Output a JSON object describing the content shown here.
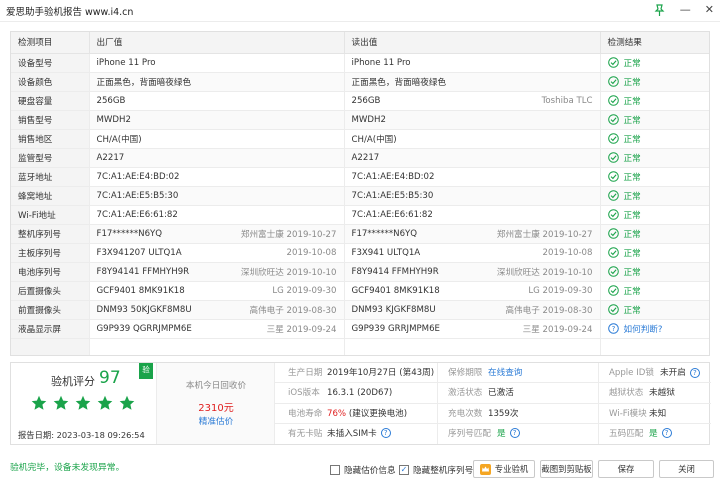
{
  "window": {
    "title": "爱思助手验机报告 www.i4.cn",
    "min": "—",
    "close": "✕"
  },
  "table": {
    "headers": [
      "检测项目",
      "出厂值",
      "读出值",
      "检测结果"
    ],
    "rows": [
      {
        "item": "设备型号",
        "factory": "iPhone 11 Pro",
        "factory_note": "",
        "read": "iPhone 11 Pro",
        "read_note": "",
        "result": "正常",
        "status": "ok"
      },
      {
        "item": "设备颜色",
        "factory": "正面黑色，背面暗夜绿色",
        "factory_note": "",
        "read": "正面黑色，背面暗夜绿色",
        "read_note": "",
        "result": "正常",
        "status": "ok"
      },
      {
        "item": "硬盘容量",
        "factory": "256GB",
        "factory_note": "",
        "read": "256GB",
        "read_note": "Toshiba TLC",
        "result": "正常",
        "status": "ok"
      },
      {
        "item": "销售型号",
        "factory": "MWDH2",
        "factory_note": "",
        "read": "MWDH2",
        "read_note": "",
        "result": "正常",
        "status": "ok"
      },
      {
        "item": "销售地区",
        "factory": "CH/A(中国)",
        "factory_note": "",
        "read": "CH/A(中国)",
        "read_note": "",
        "result": "正常",
        "status": "ok"
      },
      {
        "item": "监管型号",
        "factory": "A2217",
        "factory_note": "",
        "read": "A2217",
        "read_note": "",
        "result": "正常",
        "status": "ok"
      },
      {
        "item": "蓝牙地址",
        "factory": "7C:A1:AE:E4:BD:02",
        "factory_note": "",
        "read": "7C:A1:AE:E4:BD:02",
        "read_note": "",
        "result": "正常",
        "status": "ok"
      },
      {
        "item": "蜂窝地址",
        "factory": "7C:A1:AE:E5:B5:30",
        "factory_note": "",
        "read": "7C:A1:AE:E5:B5:30",
        "read_note": "",
        "result": "正常",
        "status": "ok"
      },
      {
        "item": "Wi-Fi地址",
        "factory": "7C:A1:AE:E6:61:82",
        "factory_note": "",
        "read": "7C:A1:AE:E6:61:82",
        "read_note": "",
        "result": "正常",
        "status": "ok"
      },
      {
        "item": "整机序列号",
        "factory": "F17******N6YQ",
        "factory_note": "郑州富士康 2019-10-27",
        "read": "F17******N6YQ",
        "read_note": "郑州富士康 2019-10-27",
        "result": "正常",
        "status": "ok"
      },
      {
        "item": "主板序列号",
        "factory": "F3X941207 ULTQ1A",
        "factory_note": "2019-10-08",
        "read": "F3X941 ULTQ1A",
        "read_note": "2019-10-08",
        "result": "正常",
        "status": "ok"
      },
      {
        "item": "电池序列号",
        "factory": "F8Y94141 FFMHYH9R",
        "factory_note": "深圳欣旺达 2019-10-10",
        "read": "F8Y9414 FFMHYH9R",
        "read_note": "深圳欣旺达 2019-10-10",
        "result": "正常",
        "status": "ok"
      },
      {
        "item": "后置摄像头",
        "factory": "GCF9401 8MK91K18",
        "factory_note": "LG 2019-09-30",
        "read": "GCF9401 8MK91K18",
        "read_note": "LG 2019-09-30",
        "result": "正常",
        "status": "ok"
      },
      {
        "item": "前置摄像头",
        "factory": "DNM93 50KJGKF8M8U",
        "factory_note": "高伟电子 2019-08-30",
        "read": "DNM93 KJGKF8M8U",
        "read_note": "高伟电子 2019-08-30",
        "result": "正常",
        "status": "ok"
      },
      {
        "item": "液晶显示屏",
        "factory": "G9P939 QGRRJMPM6E",
        "factory_note": "三星 2019-09-24",
        "read": "G9P939 GRRJMPM6E",
        "read_note": "三星 2019-09-24",
        "result": "如何判断?",
        "status": "info"
      }
    ]
  },
  "score": {
    "label": "验机评分",
    "value": "97",
    "badge": "验",
    "date_label": "报告日期:",
    "date": "2023-03-18 09:26:54",
    "stars": 5
  },
  "recycle": {
    "line1": "本机今日回收价",
    "price": "2310元",
    "estimate": "精准估价"
  },
  "info": {
    "production_date_label": "生产日期",
    "production_date": "2019年10月27日 (第43周)",
    "warranty_label": "保修期限",
    "warranty": "在线查询",
    "apple_id_label": "Apple ID锁",
    "apple_id": "未开启",
    "ios_label": "iOS版本",
    "ios": "16.3.1 (20D67)",
    "activation_label": "激活状态",
    "activation": "已激活",
    "jailbreak_label": "越狱状态",
    "jailbreak": "未越狱",
    "battery_label": "电池寿命",
    "battery": "76%",
    "battery_note": "(建议更换电池)",
    "charge_label": "充电次数",
    "charge": "1359次",
    "wifi_label": "Wi-Fi模块",
    "wifi": "未知",
    "sim_label": "有无卡贴",
    "sim": "未插入SIM卡",
    "serial_match_label": "序列号匹配",
    "serial_match": "是",
    "fivecode_label": "五码匹配",
    "fivecode": "是"
  },
  "footer": {
    "message": "验机完毕，设备未发现异常。",
    "hide_price": "隐藏估价信息",
    "hide_serial": "隐藏整机序列号",
    "pro_button": "专业验机",
    "screenshot_button": "截图到剪贴板",
    "save_button": "保存",
    "close_button": "关闭"
  },
  "colors": {
    "green": "#1aa34a",
    "blue": "#2b7bd6",
    "red": "#e02020"
  }
}
